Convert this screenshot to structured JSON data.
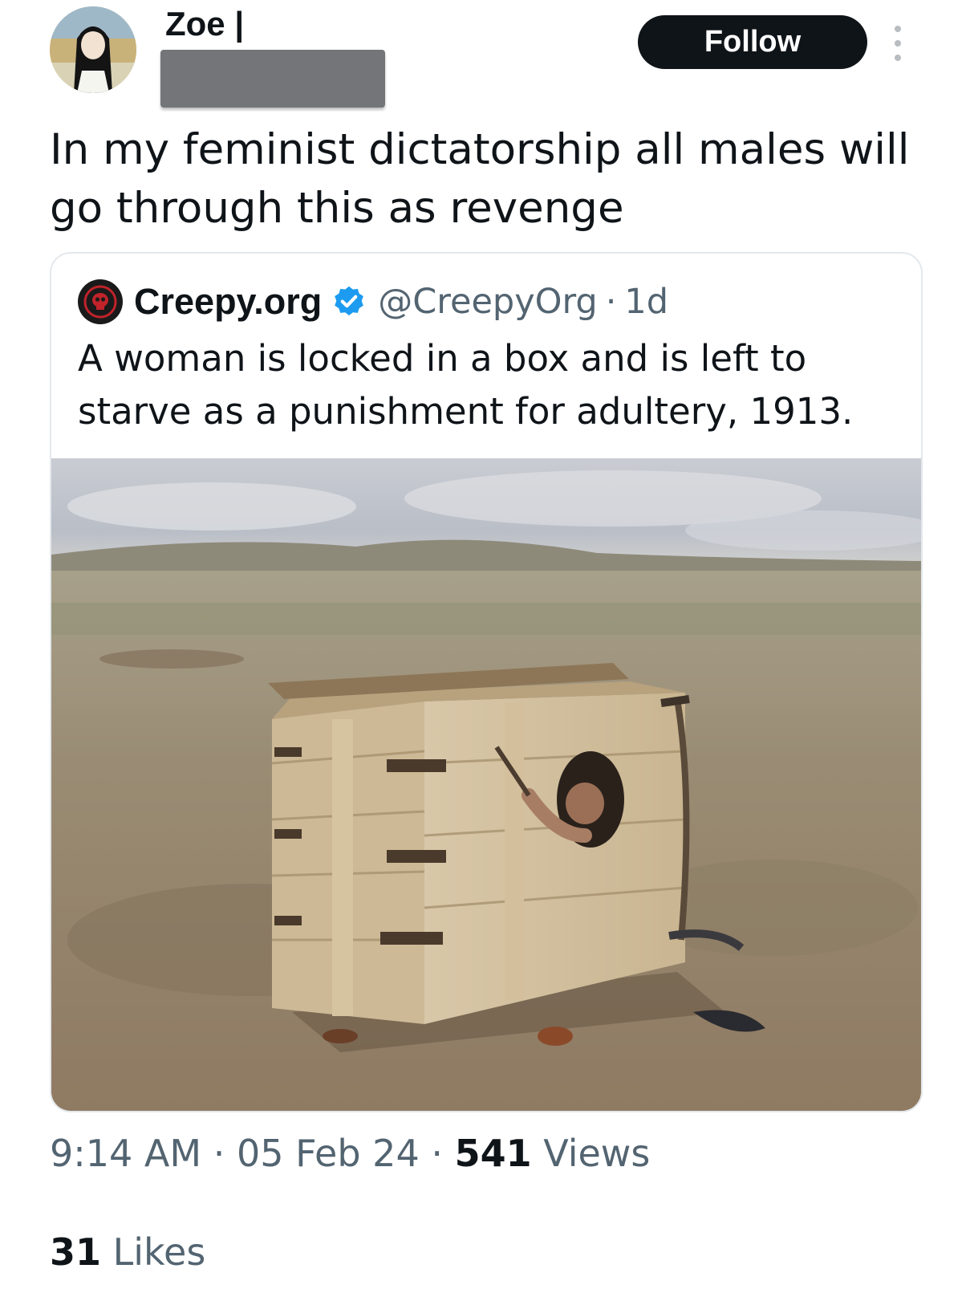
{
  "author": {
    "name": "Zoe |",
    "avatar_icon": "avatar-anime-girl-icon",
    "follow_label": "Follow",
    "more_icon": "more-vertical-icon"
  },
  "tweet": {
    "text": "In my feminist dictatorship all males will go through this as revenge"
  },
  "quoted_tweet": {
    "logo_icon": "creepy-skull-logo-icon",
    "name": "Creepy.org",
    "verified_icon": "verified-badge-icon",
    "handle": "@CreepyOrg",
    "separator": "·",
    "age": "1d",
    "text": "A woman is locked in a box and is left to starve as a punishment for adultery, 1913.",
    "image_icon": "photo-woman-in-wooden-box"
  },
  "meta": {
    "time": "9:14 AM",
    "date": "05 Feb 24",
    "separator": "·",
    "views_count": "541",
    "views_label": "Views",
    "likes_count": "31",
    "likes_label": "Likes"
  },
  "colors": {
    "text": "#0f1419",
    "secondary": "#536471",
    "follow_bg": "#0f1419",
    "verified": "#1d9bf0",
    "border": "#e4e8ec"
  }
}
